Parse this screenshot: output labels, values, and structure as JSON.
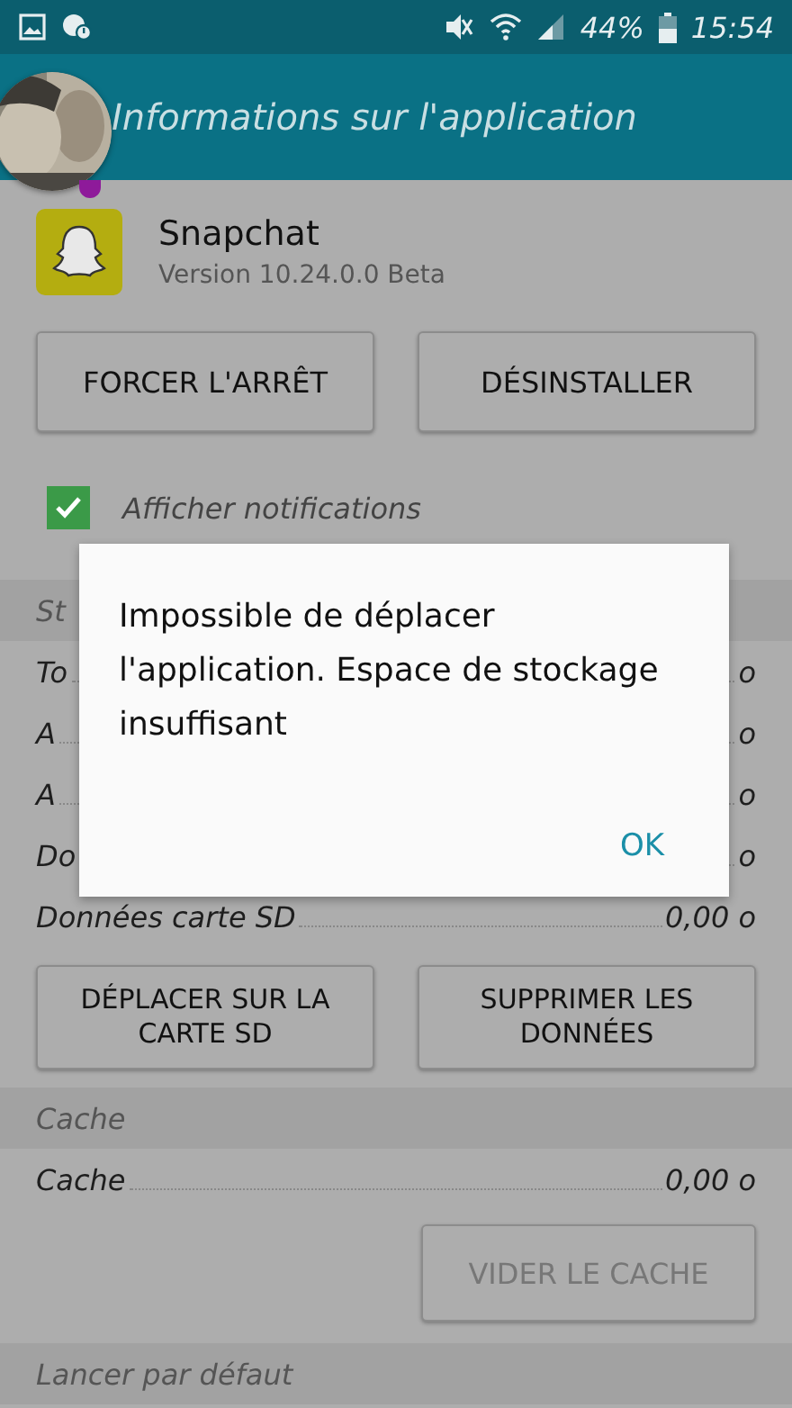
{
  "status_bar": {
    "battery_text": "44%",
    "time": "15:54"
  },
  "app_bar": {
    "title": "Informations sur l'application"
  },
  "app": {
    "name": "Snapchat",
    "version": "Version 10.24.0.0 Beta"
  },
  "top_buttons": [
    {
      "label": "FORCER L'ARRÊT",
      "disabled": false
    },
    {
      "label": "DÉSINSTALLER",
      "disabled": false
    }
  ],
  "notifications": {
    "label": "Afficher notifications",
    "checked": true
  },
  "storage": {
    "header": "St",
    "rows": [
      {
        "label": "To",
        "value": "o"
      },
      {
        "label": "A",
        "value": "o"
      },
      {
        "label": "A",
        "value": "o"
      },
      {
        "label": "Do",
        "value": "o"
      },
      {
        "label": "Données carte SD",
        "value": "0,00 o"
      }
    ]
  },
  "storage_buttons": [
    {
      "label": "DÉPLACER SUR LA CARTE SD",
      "disabled": false
    },
    {
      "label": "SUPPRIMER LES DONNÉES",
      "disabled": false
    }
  ],
  "cache": {
    "header": "Cache",
    "rows": [
      {
        "label": "Cache",
        "value": "0,00 o"
      }
    ],
    "button": {
      "label": "VIDER LE CACHE",
      "disabled": true
    }
  },
  "launch": {
    "header": "Lancer par défaut"
  },
  "dialog": {
    "message": "Impossible de déplacer l'application. Espace de stockage insuffisant",
    "button": "OK"
  }
}
